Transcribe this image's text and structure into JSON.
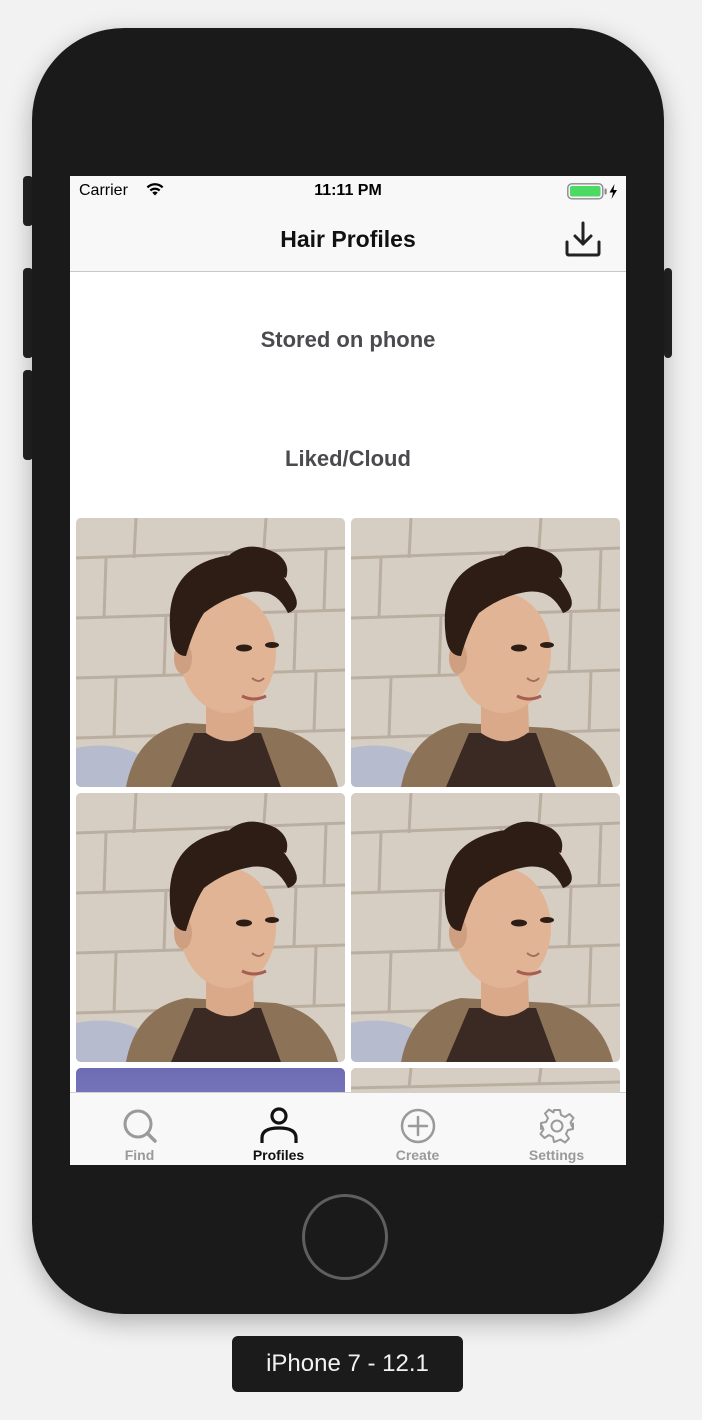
{
  "device": {
    "label": "iPhone 7 - 12.1"
  },
  "status_bar": {
    "carrier": "Carrier",
    "time": "11:11 PM",
    "battery_color": "#4cd964"
  },
  "nav": {
    "title": "Hair Profiles",
    "action_icon": "download-icon"
  },
  "sections": {
    "stored": "Stored on phone",
    "liked": "Liked/Cloud"
  },
  "photos": [
    {
      "subject": "portrait"
    },
    {
      "subject": "portrait"
    },
    {
      "subject": "portrait"
    },
    {
      "subject": "portrait"
    },
    {
      "subject": "purple-sky"
    },
    {
      "subject": "brick-wall"
    }
  ],
  "tabs": [
    {
      "label": "Find",
      "icon": "search-icon",
      "active": false
    },
    {
      "label": "Profiles",
      "icon": "person-icon",
      "active": true
    },
    {
      "label": "Create",
      "icon": "plus-circle-icon",
      "active": false
    },
    {
      "label": "Settings",
      "icon": "gear-icon",
      "active": false
    }
  ],
  "colors": {
    "active_tab": "#111111",
    "inactive_tab": "#9a9a9a",
    "section_text": "#4a4a4f"
  }
}
